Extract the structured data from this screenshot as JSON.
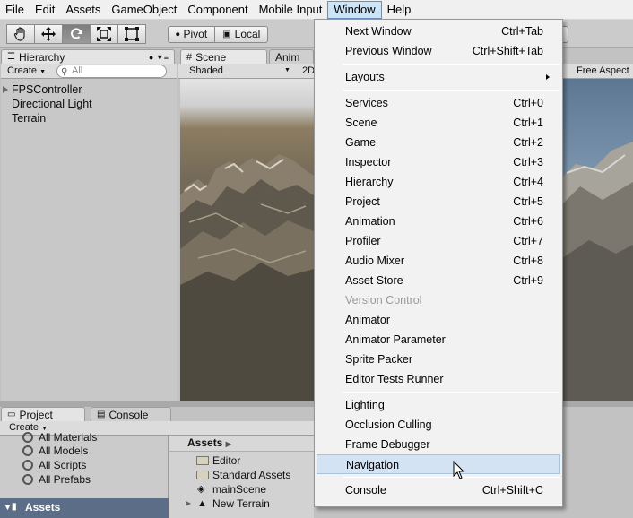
{
  "menubar": {
    "items": [
      "File",
      "Edit",
      "Assets",
      "GameObject",
      "Component",
      "Mobile Input",
      "Window",
      "Help"
    ],
    "active": "Window"
  },
  "toolbar": {
    "pivot_label": "Pivot",
    "local_label": "Local"
  },
  "hierarchy": {
    "tab_label": "Hierarchy",
    "create_label": "Create",
    "search_placeholder": "All",
    "items": [
      "FPSController",
      "Directional Light",
      "Terrain"
    ]
  },
  "scene": {
    "tab_label": "Scene",
    "anim_tab_label": "Anim",
    "shading_label": "Shaded",
    "mode_label": "2D"
  },
  "game": {
    "aspect_label": "Free Aspect"
  },
  "project": {
    "tab_label": "Project",
    "console_tab_label": "Console",
    "create_label": "Create",
    "favorites": [
      "All Materials",
      "All Models",
      "All Scripts",
      "All Prefabs"
    ],
    "assets_header": "Assets",
    "breadcrumb": "Assets",
    "assets": [
      "Editor",
      "Standard Assets",
      "mainScene",
      "New Terrain"
    ]
  },
  "window_menu": {
    "items": [
      {
        "label": "Next Window",
        "shortcut": "Ctrl+Tab"
      },
      {
        "label": "Previous Window",
        "shortcut": "Ctrl+Shift+Tab"
      },
      {
        "label": "Layouts",
        "shortcut": ""
      },
      {
        "label": "Services",
        "shortcut": "Ctrl+0"
      },
      {
        "label": "Scene",
        "shortcut": "Ctrl+1"
      },
      {
        "label": "Game",
        "shortcut": "Ctrl+2"
      },
      {
        "label": "Inspector",
        "shortcut": "Ctrl+3"
      },
      {
        "label": "Hierarchy",
        "shortcut": "Ctrl+4"
      },
      {
        "label": "Project",
        "shortcut": "Ctrl+5"
      },
      {
        "label": "Animation",
        "shortcut": "Ctrl+6"
      },
      {
        "label": "Profiler",
        "shortcut": "Ctrl+7"
      },
      {
        "label": "Audio Mixer",
        "shortcut": "Ctrl+8"
      },
      {
        "label": "Asset Store",
        "shortcut": "Ctrl+9"
      },
      {
        "label": "Version Control",
        "shortcut": ""
      },
      {
        "label": "Animator",
        "shortcut": ""
      },
      {
        "label": "Animator Parameter",
        "shortcut": ""
      },
      {
        "label": "Sprite Packer",
        "shortcut": ""
      },
      {
        "label": "Editor Tests Runner",
        "shortcut": ""
      },
      {
        "label": "Lighting",
        "shortcut": ""
      },
      {
        "label": "Occlusion Culling",
        "shortcut": ""
      },
      {
        "label": "Frame Debugger",
        "shortcut": ""
      },
      {
        "label": "Navigation",
        "shortcut": ""
      },
      {
        "label": "Console",
        "shortcut": "Ctrl+Shift+C"
      }
    ],
    "highlighted": "Navigation",
    "disabled": "Version Control"
  },
  "colors": {
    "menu_highlight": "#d4e3f3",
    "assets_header_bg": "#5b6d87"
  }
}
